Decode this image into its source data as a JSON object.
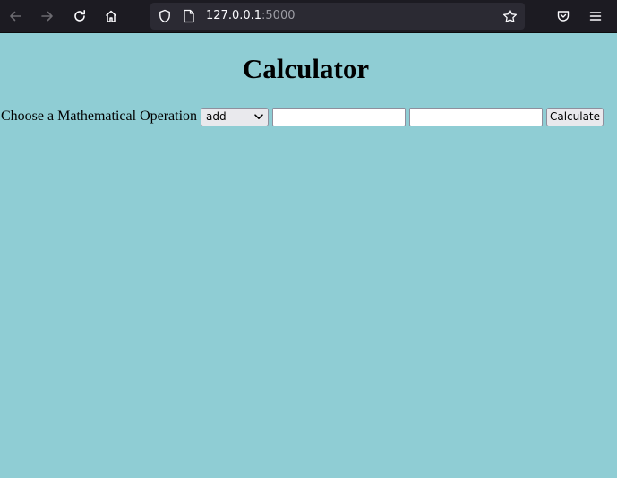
{
  "browser": {
    "url_host": "127.0.0.1",
    "url_port": ":5000",
    "icons": [
      "back-icon",
      "forward-icon",
      "reload-icon",
      "home-icon",
      "shield-icon",
      "page-icon",
      "star-icon",
      "pocket-icon",
      "menu-icon"
    ]
  },
  "page": {
    "title": "Calculator",
    "operation_label": "Choose a Mathematical Operation",
    "operation_selected": "add",
    "first_number_value": "",
    "second_number_value": "",
    "calculate_label": "Calculate",
    "background_color": "#8fcdd4"
  }
}
